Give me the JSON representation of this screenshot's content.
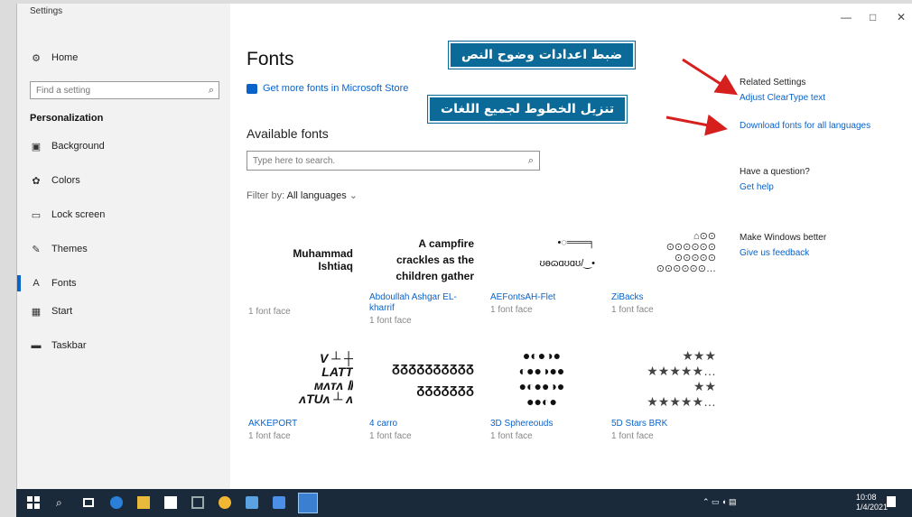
{
  "window": {
    "title": "Settings",
    "controls": [
      "—",
      "□",
      "✕"
    ]
  },
  "sidebar": {
    "home": "Home",
    "search_placeholder": "Find a setting",
    "section": "Personalization",
    "items": [
      {
        "label": "Background",
        "icon": "picture-icon"
      },
      {
        "label": "Colors",
        "icon": "palette-icon"
      },
      {
        "label": "Lock screen",
        "icon": "lock-screen-icon"
      },
      {
        "label": "Themes",
        "icon": "brush-icon"
      },
      {
        "label": "Fonts",
        "icon": "font-icon",
        "active": true
      },
      {
        "label": "Start",
        "icon": "start-grid-icon"
      },
      {
        "label": "Taskbar",
        "icon": "taskbar-icon"
      }
    ]
  },
  "main": {
    "title": "Fonts",
    "store_link": "Get more fonts in Microsoft Store",
    "available": "Available fonts",
    "search_placeholder": "Type here to search.",
    "filter_label": "Filter by:",
    "filter_value": "All languages"
  },
  "fonts": [
    {
      "preview": [
        "Muhammad",
        "Ishtiaq"
      ],
      "name": "",
      "faces": "1 font face"
    },
    {
      "preview": [
        "A campfire",
        "crackles as the",
        "children gather"
      ],
      "name": "Abdoullah Ashgar EL-kharrif",
      "faces": "1 font face"
    },
    {
      "preview": [
        "•◌═══╕",
        "ʊɵɷɑʊɑʊ/‿•"
      ],
      "name": "AEFontsAH-Flet",
      "faces": "1 font face"
    },
    {
      "preview": [
        "⌂⊙⊙",
        "⊙⊙⊙⊙⊙⊙",
        "⊙⊙⊙⊙⊙",
        "⊙⊙⊙⊙⊙⊙…"
      ],
      "name": "ZiBacks",
      "faces": "1 font face"
    },
    {
      "preview": [
        "V ┴ ┼",
        "LATT",
        "ᴍᴧᴛᴧ Ⅱ",
        "ᴧTUᴧ ┴ ᴧ"
      ],
      "name": "AKKEPORT",
      "faces": "1 font face"
    },
    {
      "preview": [
        "ᵹᵹᵹᵹᵹᵹᵹᵹᵹᵹ",
        "ᵹᵹᵹᵹᵹᵹᵹ"
      ],
      "name": "4 carro",
      "faces": "1 font face"
    },
    {
      "preview": [
        "●◐●◑●",
        "◐●●◑●●",
        "●◐●●◑●",
        "●●◐●"
      ],
      "name": "3D Sphereouds",
      "faces": "1 font face"
    },
    {
      "preview": [
        "★★★",
        "★★★★★…",
        "★★",
        "★★★★★…"
      ],
      "name": "5D Stars BRK",
      "faces": "1 font face"
    }
  ],
  "related": {
    "heading": "Related Settings",
    "link1": "Adjust ClearType text",
    "link2": "Download fonts for all languages",
    "q_heading": "Have a question?",
    "q_link": "Get help",
    "b_heading": "Make Windows better",
    "b_link": "Give us feedback"
  },
  "callouts": {
    "top": "ضبط اعدادات وضوح النص",
    "bottom": "تنزيل الخطوط لجميع اللغات"
  },
  "colors": {
    "accent": "#0a63c9",
    "callout": "#0b6a97",
    "arrow": "#d6201e",
    "taskbar": "#1b2a3b"
  },
  "taskbar": {
    "time": "10:08",
    "date": "1/4/2021"
  }
}
